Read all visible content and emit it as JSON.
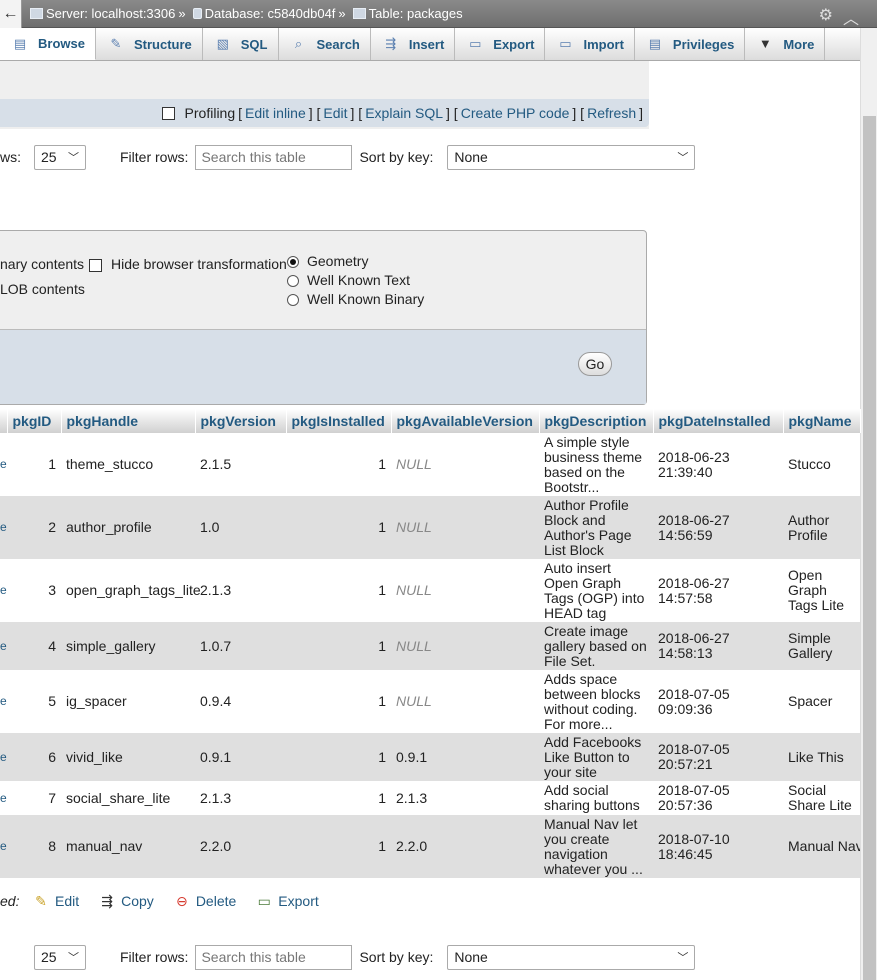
{
  "topbar": {
    "back": "←",
    "server": "Server: localhost:3306",
    "database": "Database: c5840db04f",
    "table": "Table: packages",
    "sep": "»"
  },
  "tabs": [
    {
      "label": "Browse",
      "icon": "browse-icon"
    },
    {
      "label": "Structure",
      "icon": "structure-icon"
    },
    {
      "label": "SQL",
      "icon": "sql-icon"
    },
    {
      "label": "Search",
      "icon": "search-icon"
    },
    {
      "label": "Insert",
      "icon": "insert-icon"
    },
    {
      "label": "Export",
      "icon": "export-icon"
    },
    {
      "label": "Import",
      "icon": "import-icon"
    },
    {
      "label": "Privileges",
      "icon": "privileges-icon"
    },
    {
      "label": "More",
      "icon": "chevron-down-icon"
    }
  ],
  "query_links": {
    "profiling": "Profiling",
    "edit_inline": "Edit inline",
    "edit": "Edit",
    "explain_sql": "Explain SQL",
    "create_php": "Create PHP code",
    "refresh": "Refresh"
  },
  "nav_top": {
    "rows_label": "ws:",
    "rows_value": "25",
    "filter_label": "Filter rows:",
    "filter_placeholder": "Search this table",
    "sort_label": "Sort by key:",
    "sort_value": "None"
  },
  "options": {
    "binary_contents": "nary contents",
    "hide_browser_transformation": "Hide browser transformation",
    "blob_contents": "LOB contents",
    "geometry": "Geometry",
    "well_known_text": "Well Known Text",
    "well_known_binary": "Well Known Binary",
    "go": "Go"
  },
  "table": {
    "columns": [
      "pkgID",
      "pkgHandle",
      "pkgVersion",
      "pkgIsInstalled",
      "pkgAvailableVersion",
      "pkgDescription",
      "pkgDateInstalled",
      "pkgName"
    ],
    "edge_text": "e",
    "rows": [
      {
        "pkgID": "1",
        "pkgHandle": "theme_stucco",
        "pkgVersion": "2.1.5",
        "pkgIsInstalled": "1",
        "pkgAvailableVersion": "NULL",
        "pkgDescription": "A simple style business theme based on the Bootstr...",
        "pkgDateInstalled": "2018-06-23 21:39:40",
        "pkgName": "Stucco"
      },
      {
        "pkgID": "2",
        "pkgHandle": "author_profile",
        "pkgVersion": "1.0",
        "pkgIsInstalled": "1",
        "pkgAvailableVersion": "NULL",
        "pkgDescription": "Author Profile Block and Author's Page List Block",
        "pkgDateInstalled": "2018-06-27 14:56:59",
        "pkgName": "Author Profile"
      },
      {
        "pkgID": "3",
        "pkgHandle": "open_graph_tags_lite",
        "pkgVersion": "2.1.3",
        "pkgIsInstalled": "1",
        "pkgAvailableVersion": "NULL",
        "pkgDescription": "Auto insert Open Graph Tags (OGP) into HEAD tag",
        "pkgDateInstalled": "2018-06-27 14:57:58",
        "pkgName": "Open Graph Tags Lite"
      },
      {
        "pkgID": "4",
        "pkgHandle": "simple_gallery",
        "pkgVersion": "1.0.7",
        "pkgIsInstalled": "1",
        "pkgAvailableVersion": "NULL",
        "pkgDescription": "Create image gallery based on File Set.",
        "pkgDateInstalled": "2018-06-27 14:58:13",
        "pkgName": "Simple Gallery"
      },
      {
        "pkgID": "5",
        "pkgHandle": "ig_spacer",
        "pkgVersion": "0.9.4",
        "pkgIsInstalled": "1",
        "pkgAvailableVersion": "NULL",
        "pkgDescription": "Adds space between blocks without coding. For more...",
        "pkgDateInstalled": "2018-07-05 09:09:36",
        "pkgName": "Spacer"
      },
      {
        "pkgID": "6",
        "pkgHandle": "vivid_like",
        "pkgVersion": "0.9.1",
        "pkgIsInstalled": "1",
        "pkgAvailableVersion": "0.9.1",
        "pkgDescription": "Add Facebooks Like Button to your site",
        "pkgDateInstalled": "2018-07-05 20:57:21",
        "pkgName": "Like This"
      },
      {
        "pkgID": "7",
        "pkgHandle": "social_share_lite",
        "pkgVersion": "2.1.3",
        "pkgIsInstalled": "1",
        "pkgAvailableVersion": "2.1.3",
        "pkgDescription": "Add social sharing buttons",
        "pkgDateInstalled": "2018-07-05 20:57:36",
        "pkgName": "Social Share Lite"
      },
      {
        "pkgID": "8",
        "pkgHandle": "manual_nav",
        "pkgVersion": "2.2.0",
        "pkgIsInstalled": "1",
        "pkgAvailableVersion": "2.2.0",
        "pkgDescription": "Manual Nav let you create navigation whatever you ...",
        "pkgDateInstalled": "2018-07-10 18:46:45",
        "pkgName": "Manual Nav"
      }
    ]
  },
  "bulk": {
    "label": "ed:",
    "edit": "Edit",
    "copy": "Copy",
    "delete": "Delete",
    "export": "Export"
  },
  "nav_bottom": {
    "rows_value": "25",
    "filter_label": "Filter rows:",
    "filter_placeholder": "Search this table",
    "sort_label": "Sort by key:",
    "sort_value": "None"
  }
}
